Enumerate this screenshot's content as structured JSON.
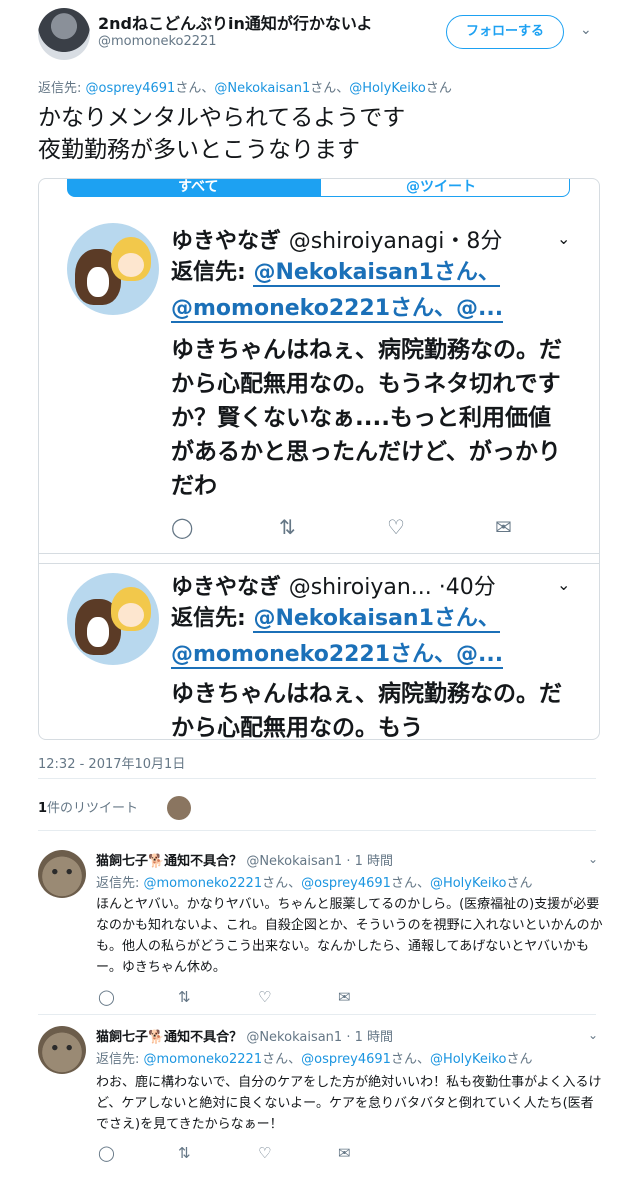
{
  "tweet": {
    "author_name": "2ndねこどんぶりin通知が行かないよ",
    "author_handle": "@momoneko2221",
    "follow_label": "フォローする",
    "reply_prefix": "返信先: ",
    "reply_users": [
      "@osprey4691",
      "@Nekokaisan1",
      "@HolyKeiko"
    ],
    "reply_suffix": "さん",
    "reply_sep": "、",
    "text_line1": "かなりメンタルやられてるようです",
    "text_line2": "夜勤勤務が多いとこうなります",
    "timestamp": "12:32 - 2017年10月1日",
    "retweet_count": "1",
    "retweet_label": "件のリツイート"
  },
  "embed": {
    "tab_left": "すべて",
    "tab_right": "@ツイート",
    "tweets": [
      {
        "name": "ゆきやなぎ",
        "handle_time": "@shiroiyanagi・8分",
        "reply_label": "返信先: ",
        "reply_line1": "@Nekokaisan1さん、",
        "reply_line2": "@momoneko2221さん、@...",
        "text": "ゆきちゃんはねぇ、病院勤務なの。だから心配無用なの。もうネタ切れですか？賢くないなぁ....もっと利用価値があるかと思ったんだけど、がっかりだわ"
      },
      {
        "name": "ゆきやなぎ",
        "handle_time": "@shiroiyan...  ·40分",
        "reply_label": "返信先: ",
        "reply_line1": "@Nekokaisan1さん、",
        "reply_line2": "@momoneko2221さん、@...",
        "text": "ゆきちゃんはねぇ、病院勤務なの。だから心配無用なの。もう"
      }
    ]
  },
  "replies": [
    {
      "name": "猫飼七子🐕通知不具合？",
      "handle": "@Nekokaisan1",
      "time": "· 1 時間",
      "reply_prefix": "返信先: ",
      "reply_users": [
        "@momoneko2221",
        "@osprey4691",
        "@HolyKeiko"
      ],
      "text": "ほんとヤバい。かなりヤバい。ちゃんと服薬してるのかしら。(医療福祉の)支援が必要なのかも知れないよ、これ。自殺企図とか、そういうのを視野に入れないといかんのかも。他人の私らがどうこう出来ない。なんかしたら、通報してあげないとヤバいかもー。ゆきちゃん休め。"
    },
    {
      "name": "猫飼七子🐕通知不具合？",
      "handle": "@Nekokaisan1",
      "time": "· 1 時間",
      "reply_prefix": "返信先: ",
      "reply_users": [
        "@momoneko2221",
        "@osprey4691",
        "@HolyKeiko"
      ],
      "text": "わお、鹿に構わないで、自分のケアをした方が絶対いいわ！私も夜勤仕事がよく入るけど、ケアしないと絶対に良くないよー。ケアを怠りバタバタと倒れていく人たち(医者でさえ)を見てきたからなぁー！"
    }
  ],
  "colors": {
    "link": "#1b95e0",
    "meta": "#657786",
    "border": "#e6ecf0"
  },
  "icons": [
    "reply-icon",
    "retweet-icon",
    "like-icon",
    "dm-icon",
    "chevron-down-icon"
  ]
}
